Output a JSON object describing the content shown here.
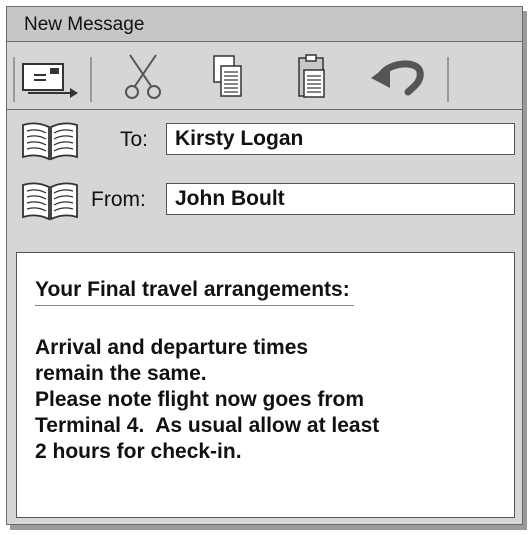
{
  "window": {
    "title": "New Message"
  },
  "toolbar": {
    "buttons": [
      {
        "icon": "send-envelope-icon"
      },
      {
        "icon": "scissors-icon"
      },
      {
        "icon": "copy-icon"
      },
      {
        "icon": "paste-icon"
      },
      {
        "icon": "undo-icon"
      }
    ]
  },
  "to": {
    "label": "To:",
    "value": "Kirsty Logan",
    "icon": "address-book-icon"
  },
  "from": {
    "label": "From:",
    "value": "John Boult",
    "icon": "address-book-icon"
  },
  "message": {
    "subject": "Your Final travel arrangements:",
    "lines": [
      "Arrival and departure times",
      "remain the same.",
      "Please note flight now goes from",
      "Terminal 4.  As usual allow at least",
      "2 hours for check-in."
    ]
  }
}
